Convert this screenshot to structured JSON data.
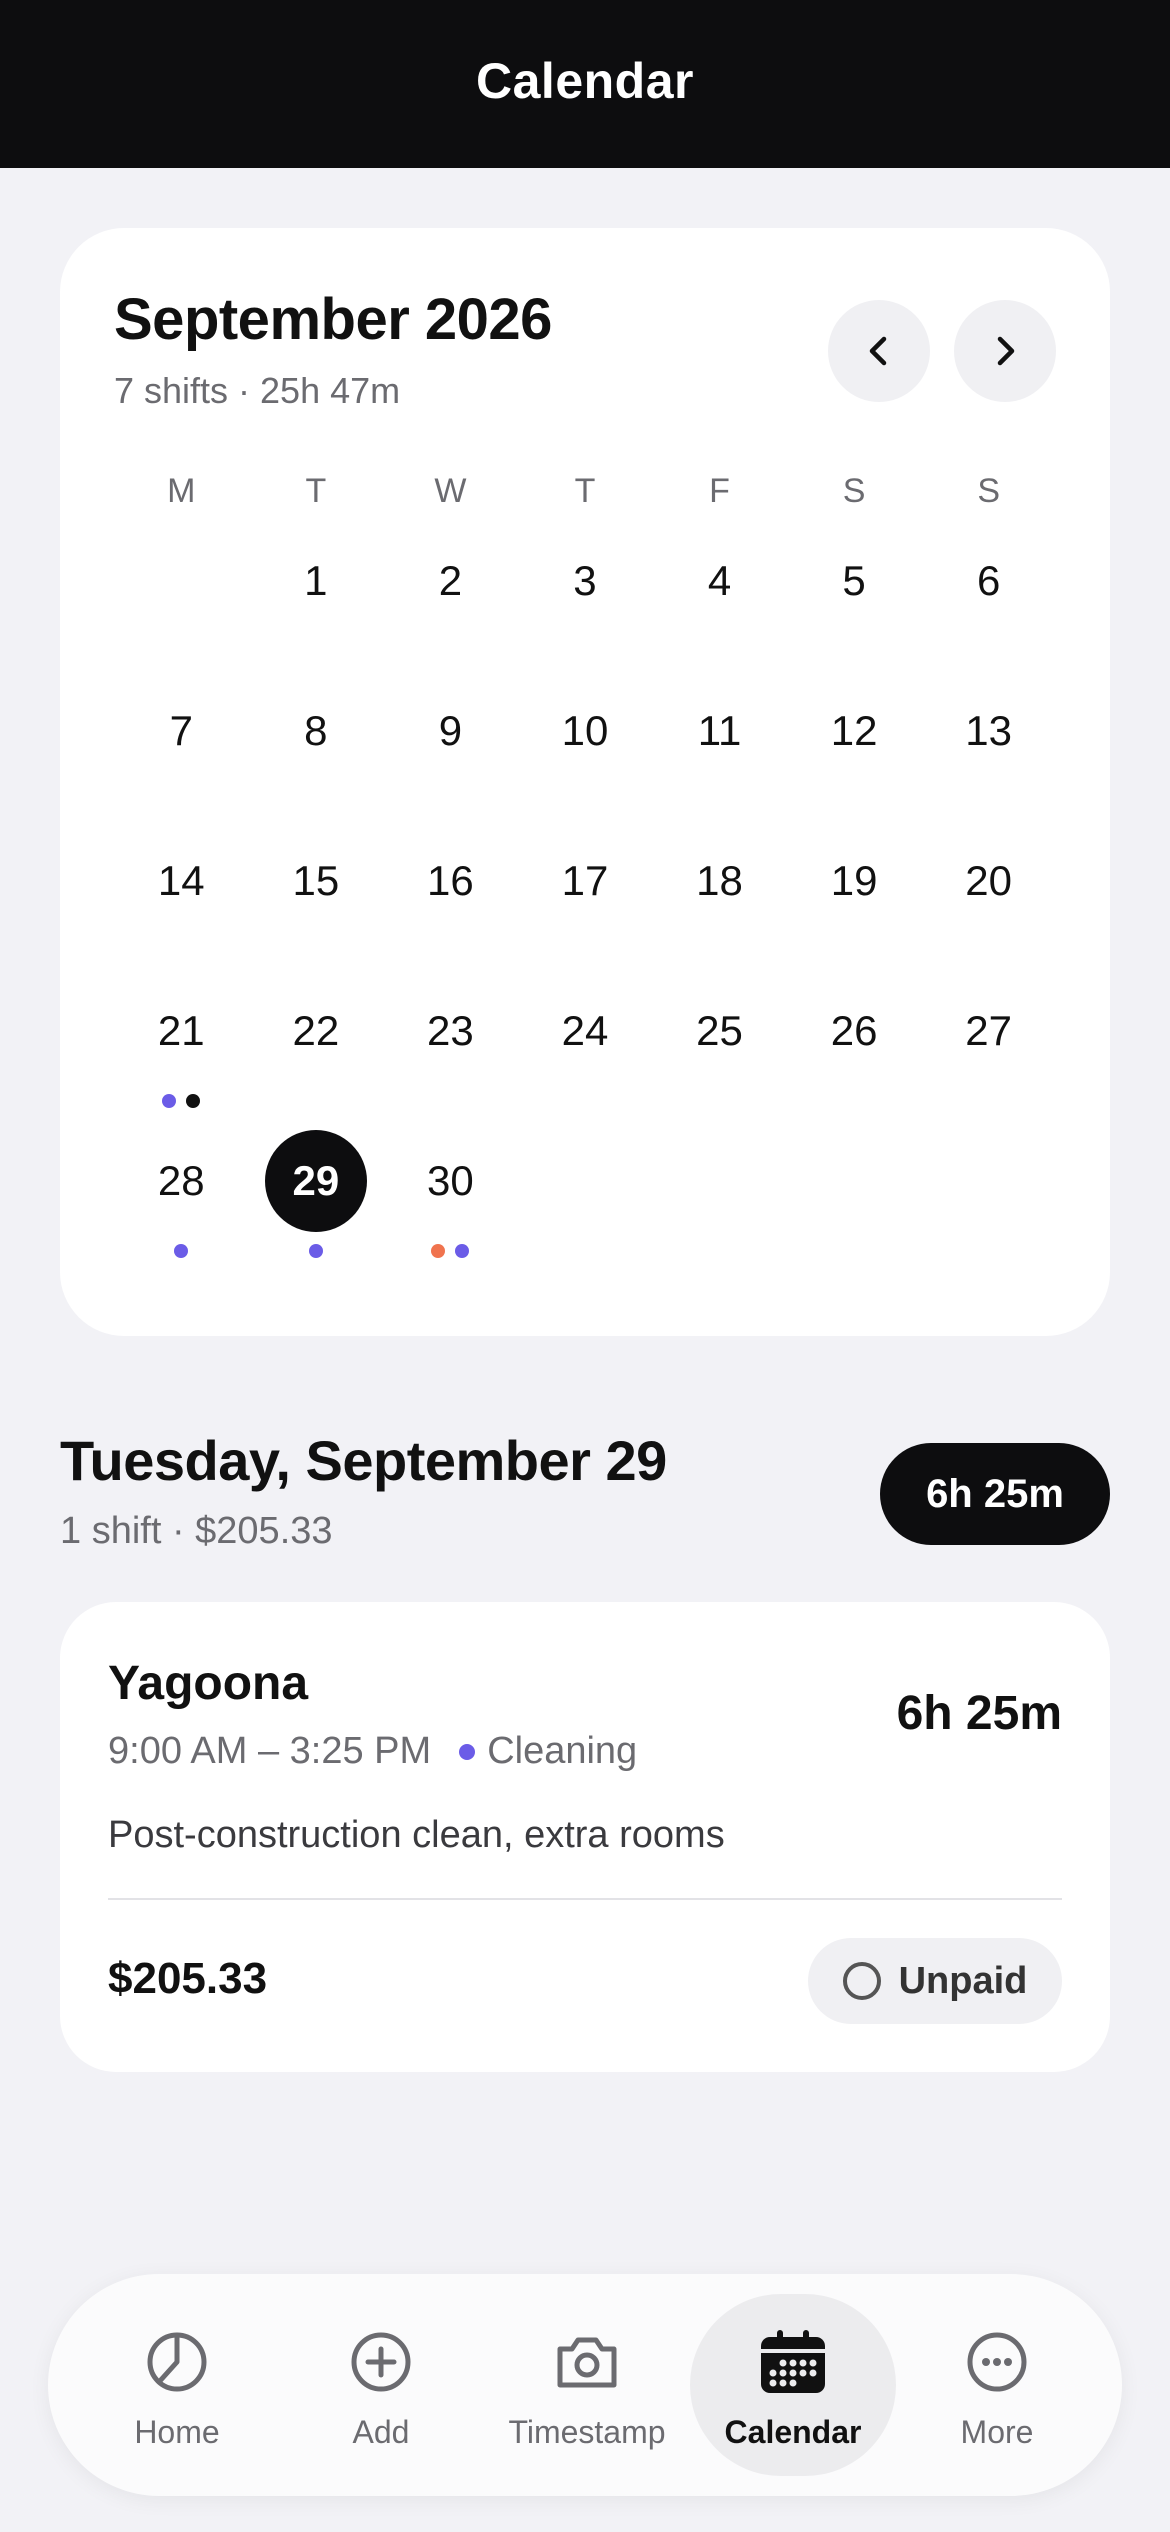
{
  "header": {
    "title": "Calendar"
  },
  "calendar": {
    "month_title": "September 2026",
    "summary": "7 shifts · 25h 47m",
    "weekdays": [
      "M",
      "T",
      "W",
      "T",
      "F",
      "S",
      "S"
    ],
    "selected_day": 29,
    "weeks": [
      [
        null,
        1,
        2,
        3,
        4,
        5,
        6
      ],
      [
        7,
        8,
        9,
        10,
        11,
        12,
        13
      ],
      [
        14,
        15,
        16,
        17,
        18,
        19,
        20
      ],
      [
        21,
        22,
        23,
        24,
        25,
        26,
        27
      ],
      [
        28,
        29,
        30,
        null,
        null,
        null,
        null
      ]
    ],
    "day_markers": {
      "21": [
        "#6b5ce7",
        "#111111"
      ],
      "28": [
        "#6b5ce7"
      ],
      "29": [
        "#6b5ce7"
      ],
      "30": [
        "#f0734e",
        "#6b5ce7"
      ]
    }
  },
  "selected": {
    "title": "Tuesday, September 29",
    "summary": "1 shift · $205.33",
    "total": "6h 25m"
  },
  "shift": {
    "place": "Yagoona",
    "time": "9:00 AM – 3:25 PM",
    "category": "Cleaning",
    "category_color": "#6b5ce7",
    "duration": "6h 25m",
    "note": "Post-construction clean, extra rooms",
    "amount": "$205.33",
    "status": "Unpaid"
  },
  "tabbar": {
    "items": [
      {
        "label": "Home",
        "icon": "pie-chart-icon"
      },
      {
        "label": "Add",
        "icon": "plus-circle-icon"
      },
      {
        "label": "Timestamp",
        "icon": "camera-icon"
      },
      {
        "label": "Calendar",
        "icon": "calendar-icon",
        "active": true
      },
      {
        "label": "More",
        "icon": "more-icon"
      }
    ]
  }
}
